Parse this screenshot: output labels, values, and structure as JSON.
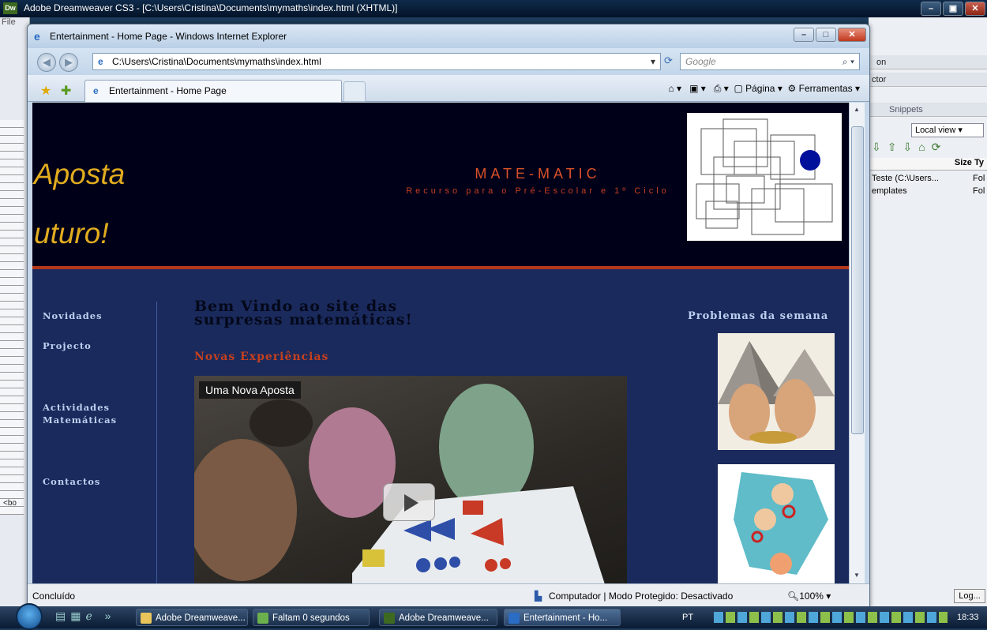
{
  "dw": {
    "title": "Adobe Dreamweaver CS3 - [C:\\Users\\Cristina\\Documents\\mymaths\\index.html (XHTML)]",
    "logo": "Dw",
    "menu": "File",
    "left_tag": "<bo",
    "right_panel": {
      "label_on": "on",
      "label_ctor": "ctor",
      "snippets": "Snippets",
      "local_view": "Local view",
      "size_col": "Size",
      "type_col": "Ty",
      "rows": [
        {
          "name": "Teste (C:\\Users...",
          "type": "Fol"
        },
        {
          "name": "emplates",
          "type": "Fol"
        }
      ],
      "log_button": "Log..."
    }
  },
  "ie": {
    "title": "Entertainment - Home Page - Windows Internet Explorer",
    "address": "C:\\Users\\Cristina\\Documents\\mymaths\\index.html",
    "search_placeholder": "Google",
    "tab_label": "Entertainment - Home Page",
    "page_menu": "Página",
    "tools_menu": "Ferramentas",
    "status_text": "Concluído",
    "zone_text": "Computador | Modo Protegido: Desactivado",
    "zoom": "100%"
  },
  "site": {
    "slogan_line1": "Aposta",
    "slogan_line2": "uturo!",
    "title": "MATE-MATIC",
    "subtitle": "Recurso para o Pré-Escolar e 1º Ciclo",
    "nav": [
      "Novidades",
      "Projecto",
      "Actividades",
      "Matemáticas",
      "Contactos"
    ],
    "welcome": "Bem Vindo ao site das surpresas matemáticas!",
    "subheading": "Novas Experiências",
    "video_title": "Uma Nova Aposta",
    "rating_stars": "☆☆☆☆☆",
    "problems_title": "Problemas da semana"
  },
  "taskbar": {
    "items": [
      "Adobe Dreamweave...",
      "Faltam 0 segundos",
      "Adobe Dreamweave...",
      "Entertainment - Ho..."
    ],
    "lang": "PT",
    "clock": "18:33"
  },
  "colors": {
    "header_bg": "#000018",
    "content_bg": "#1a2a5c",
    "accent_red": "#c5401e",
    "slogan_gold": "#e1ac1f",
    "nav_text": "#bcd0f0"
  }
}
